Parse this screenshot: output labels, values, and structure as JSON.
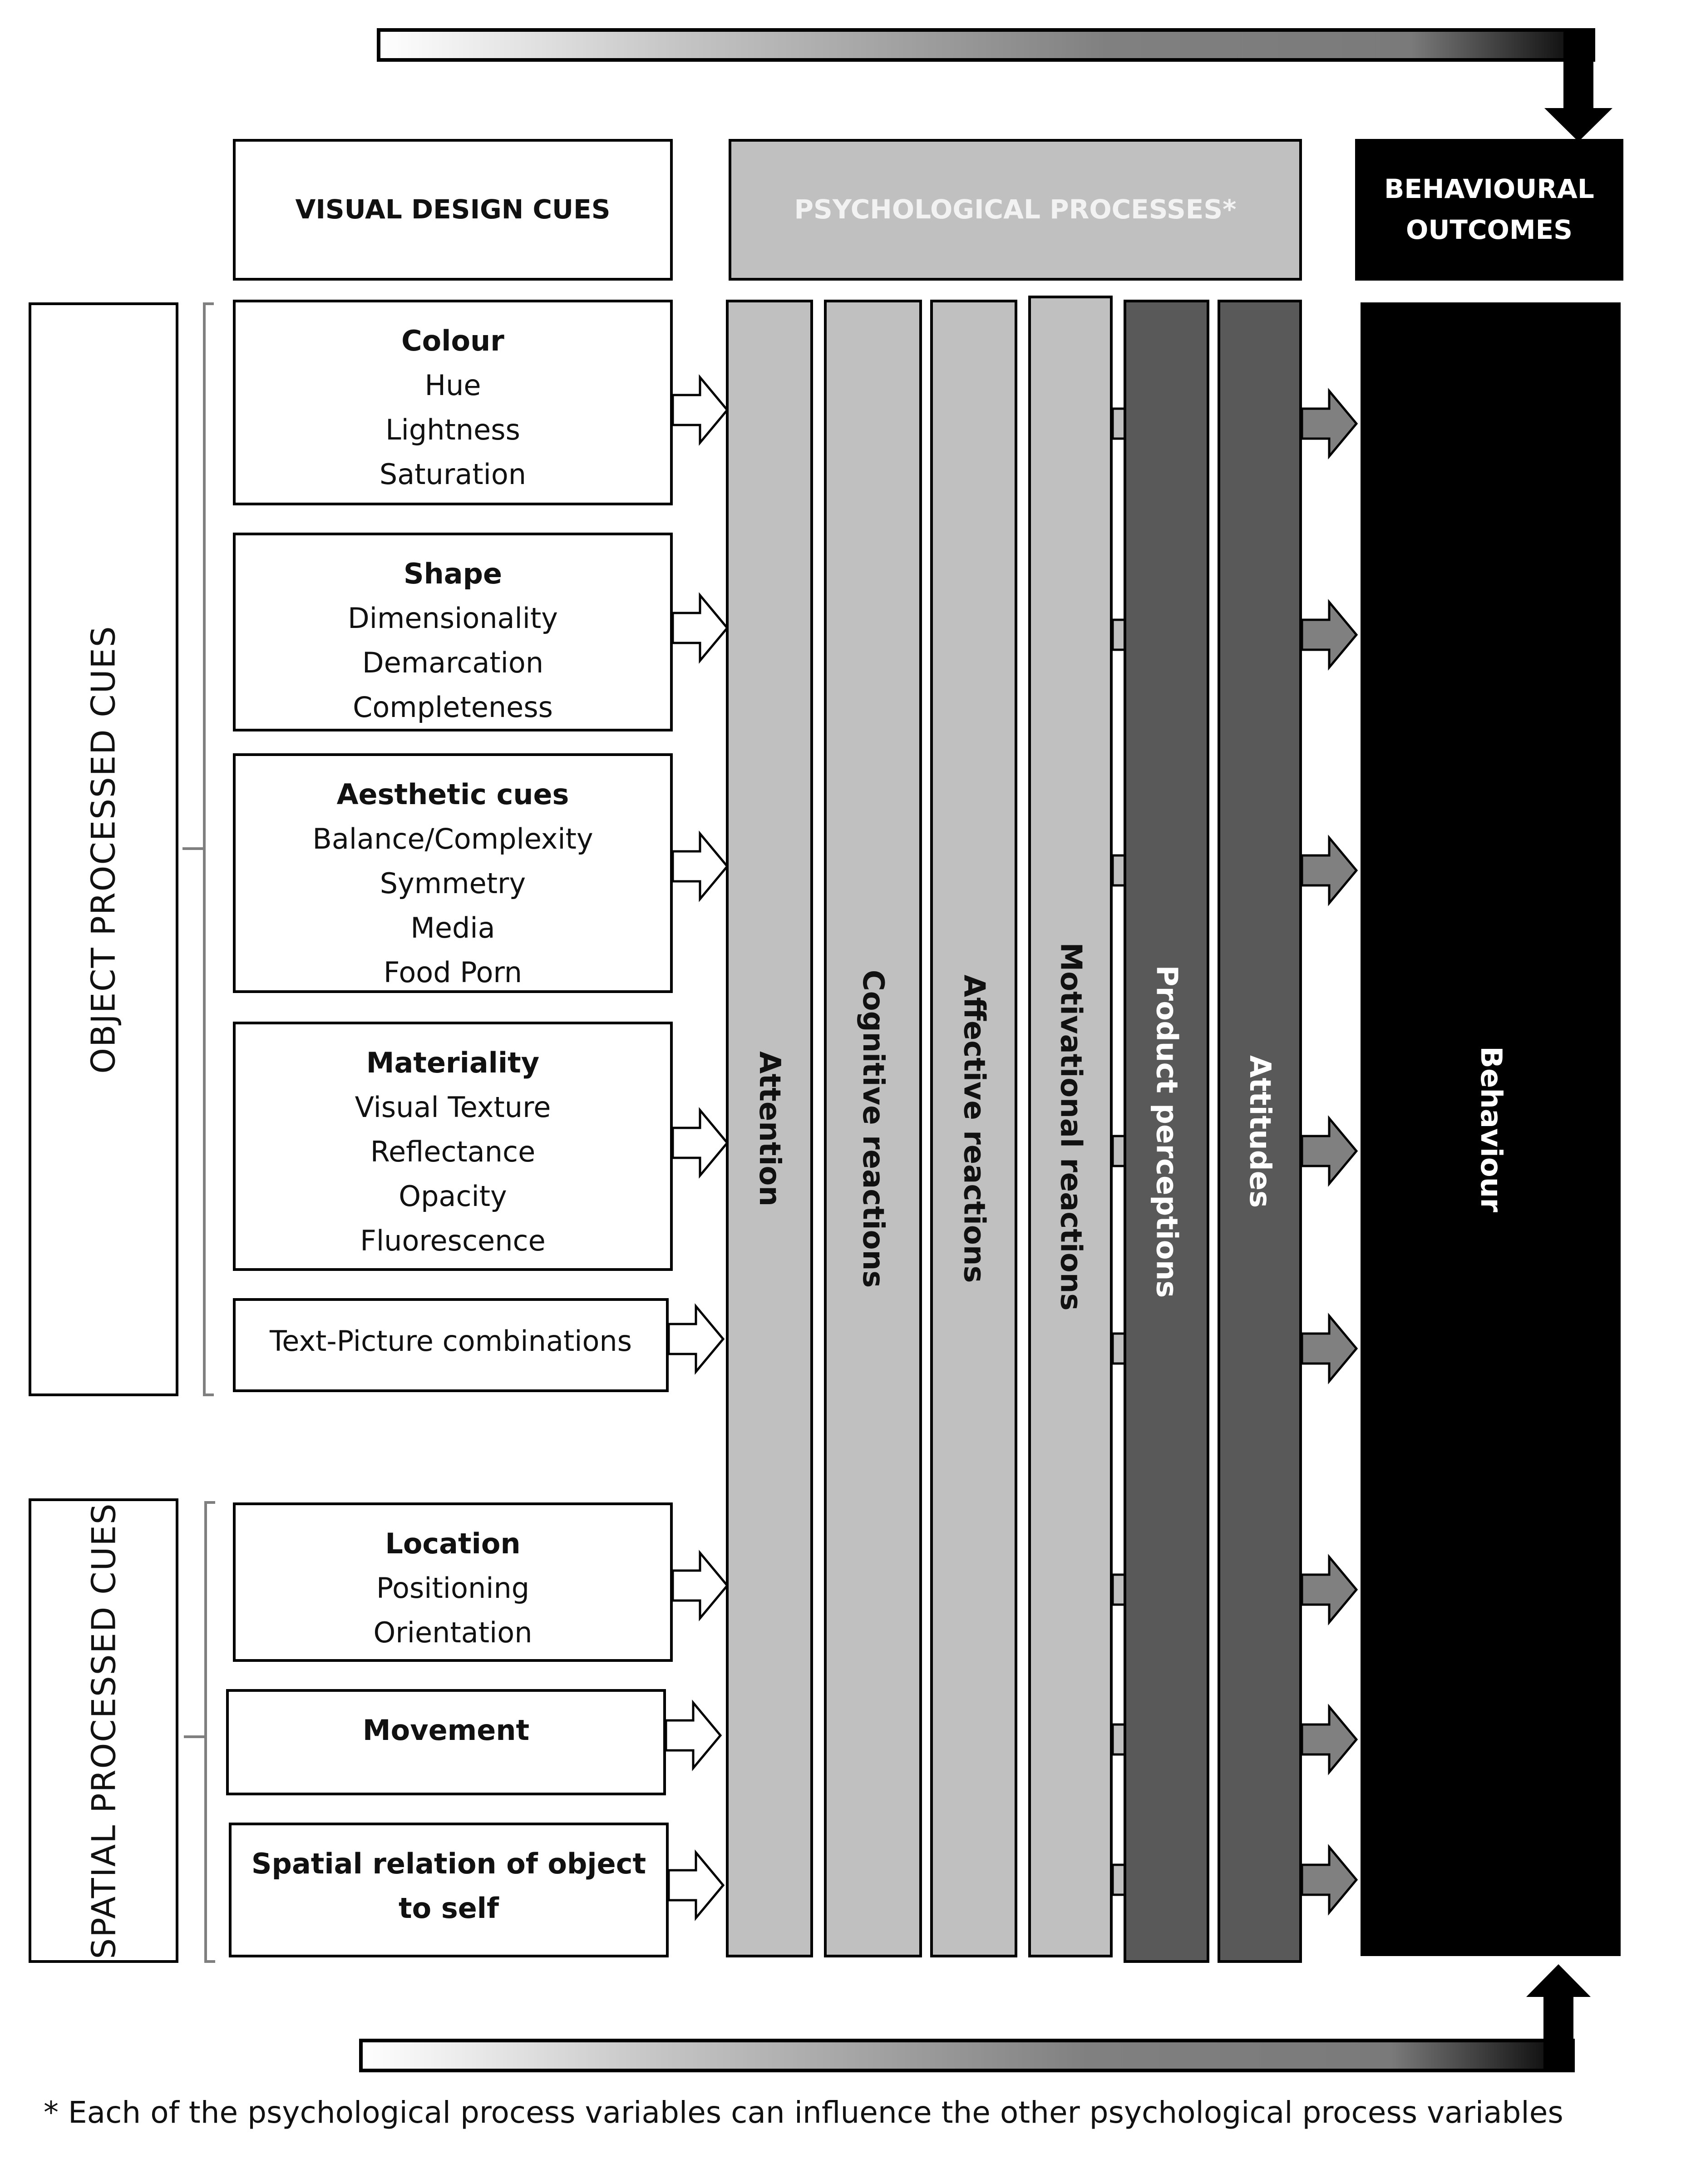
{
  "headers": {
    "visual_design_cues": "VISUAL DESIGN CUES",
    "psychological_processes": "PSYCHOLOGICAL PROCESSES*",
    "behavioural_outcomes_line1": "BEHAVIOURAL",
    "behavioural_outcomes_line2": "OUTCOMES"
  },
  "groups": {
    "object": "OBJECT PROCESSED CUES",
    "spatial": "SPATIAL PROCESSED CUES"
  },
  "cues": [
    {
      "title": "Colour",
      "items": [
        "Hue",
        "Lightness",
        "Saturation"
      ]
    },
    {
      "title": "Shape",
      "items": [
        "Dimensionality",
        "Demarcation",
        "Completeness"
      ]
    },
    {
      "title": "Aesthetic cues",
      "items": [
        "Balance/Complexity",
        "Symmetry",
        "Media",
        "Food Porn"
      ]
    },
    {
      "title": "Materiality",
      "items": [
        "Visual Texture",
        "Reflectance",
        "Opacity",
        "Fluorescence"
      ]
    },
    {
      "title": "Text-Picture combinations",
      "items": []
    },
    {
      "title": "Location",
      "items": [
        "Positioning",
        "Orientation"
      ]
    },
    {
      "title": "Movement",
      "items": []
    },
    {
      "title": "Spatial relation of object",
      "items": [
        "to self"
      ]
    }
  ],
  "processes": [
    {
      "label": "Attention",
      "shade": "light"
    },
    {
      "label": "Cognitive reactions",
      "shade": "light"
    },
    {
      "label": "Affective reactions",
      "shade": "light"
    },
    {
      "label": "Motivational reactions",
      "shade": "light"
    },
    {
      "label": "Product perceptions",
      "shade": "dark"
    },
    {
      "label": "Attitudes",
      "shade": "dark"
    }
  ],
  "outcome": "Behaviour",
  "footnote": "* Each of the psychological process variables can influence the other psychological process variables",
  "colors": {
    "light_process": "#c0c0c0",
    "dark_process": "#595959",
    "outcome": "#000000",
    "bracket": "#7f7f7f"
  }
}
